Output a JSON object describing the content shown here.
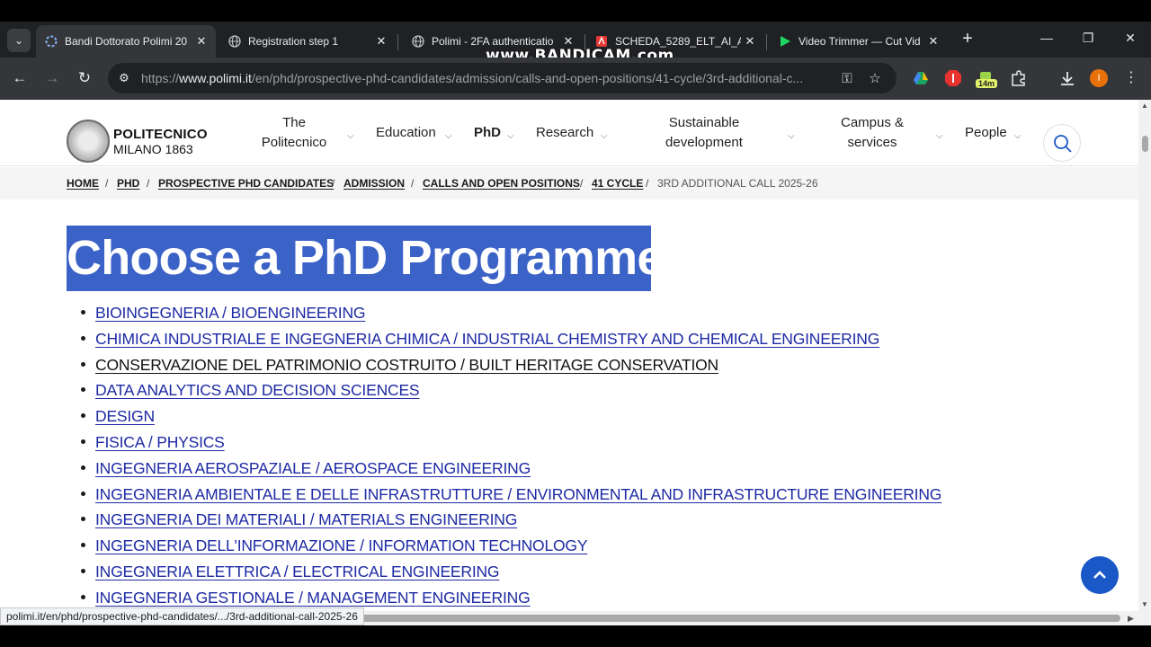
{
  "watermark": "www.BANDICAM.com",
  "browser": {
    "tabs": [
      {
        "title": "Bandi Dottorato Polimi 20",
        "active": true
      },
      {
        "title": "Registration step 1",
        "active": false
      },
      {
        "title": "Polimi - 2FA authenticatio",
        "active": false
      },
      {
        "title": "SCHEDA_5289_ELT_AI_AN",
        "active": false
      },
      {
        "title": "Video Trimmer — Cut Vid",
        "active": false
      }
    ],
    "url_prefix": "https://",
    "url_host": "www.polimi.it",
    "url_path": "/en/phd/prospective-phd-candidates/admission/calls-and-open-positions/41-cycle/3rd-additional-c...",
    "extension_badge": "14m",
    "profile_initial": "I",
    "status_url": "polimi.it/en/phd/prospective-phd-candidates/.../3rd-additional-call-2025-26"
  },
  "site": {
    "logo_line1": "POLITECNICO",
    "logo_line2": "MILANO 1863",
    "nav": {
      "politecnico": "The Politecnico",
      "education": "Education",
      "phd": "PhD",
      "research": "Research",
      "sustainable": "Sustainable development",
      "campus": "Campus & services",
      "people": "People"
    }
  },
  "breadcrumb": {
    "home": "HOME",
    "phd": "PHD",
    "prospective": "PROSPECTIVE PHD CANDIDATES",
    "admission": "ADMISSION",
    "calls": "CALLS AND OPEN POSITIONS",
    "cycle": "41 CYCLE",
    "current": "3RD ADDITIONAL CALL 2025-26"
  },
  "main": {
    "heading": "Choose a PhD Programme",
    "programmes": [
      "BIOINGEGNERIA / BIOENGINEERING",
      "CHIMICA INDUSTRIALE E INGEGNERIA CHIMICA / INDUSTRIAL CHEMISTRY AND CHEMICAL ENGINEERING",
      "CONSERVAZIONE DEL PATRIMONIO COSTRUITO / BUILT HERITAGE CONSERVATION",
      "DATA ANALYTICS AND DECISION SCIENCES",
      "DESIGN",
      "FISICA / PHYSICS",
      "INGEGNERIA AEROSPAZIALE / AEROSPACE ENGINEERING",
      "INGEGNERIA AMBIENTALE E DELLE INFRASTRUTTURE / ENVIRONMENTAL AND INFRASTRUCTURE ENGINEERING",
      "INGEGNERIA DEI MATERIALI / MATERIALS ENGINEERING",
      "INGEGNERIA DELL'INFORMAZIONE / INFORMATION TECHNOLOGY",
      "INGEGNERIA ELETTRICA / ELECTRICAL ENGINEERING",
      "INGEGNERIA GESTIONALE / MANAGEMENT ENGINEERING"
    ]
  }
}
